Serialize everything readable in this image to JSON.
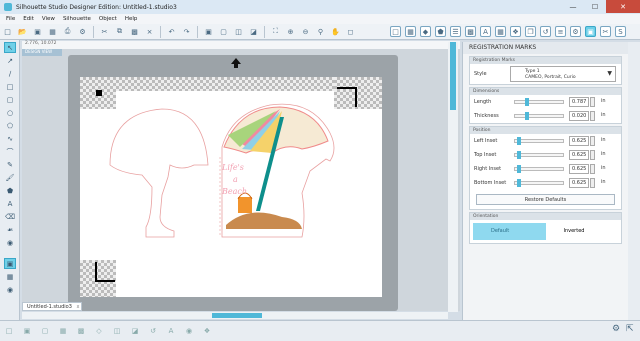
{
  "window": {
    "title": "Silhouette Studio Designer Edition: Untitled-1.studio3"
  },
  "menu": [
    "File",
    "Edit",
    "View",
    "Silhouette",
    "Object",
    "Help"
  ],
  "ruler": {
    "coords": "2.776, 10.072"
  },
  "design_view_label": "DESIGN VIEW",
  "document_tab": {
    "label": "Untitled-1.studio3",
    "close": "x"
  },
  "canvas_text": {
    "line1": "Life's",
    "line2": "a",
    "line3": "Beach"
  },
  "panel": {
    "title": "REGISTRATION MARKS",
    "registration_section": "Registration Marks",
    "style_label": "Style",
    "style_type": "Type 1",
    "style_desc": "CAMEO, Portrait, Curio",
    "dimensions_section": "Dimensions",
    "length_label": "Length",
    "length_value": "0.787",
    "thickness_label": "Thickness",
    "thickness_value": "0.020",
    "position_section": "Position",
    "left_inset_label": "Left Inset",
    "left_inset_value": "0.625",
    "top_inset_label": "Top Inset",
    "top_inset_value": "0.625",
    "right_inset_label": "Right Inset",
    "right_inset_value": "0.625",
    "bottom_inset_label": "Bottom Inset",
    "bottom_inset_value": "0.625",
    "unit": "in",
    "restore_button": "Restore Defaults",
    "orientation_section": "Orientation",
    "orientation_default": "Default",
    "orientation_inverted": "Inverted",
    "length_fraction": 0.22,
    "thickness_fraction": 0.22,
    "left_inset_fraction": 0.05,
    "top_inset_fraction": 0.05,
    "right_inset_fraction": 0.05,
    "bottom_inset_fraction": 0.05
  },
  "colors": {
    "accent": "#4fb8d8",
    "close": "#c84b3c",
    "cut_line": "#e8a0a0",
    "text_pink": "#f2a1b2"
  }
}
